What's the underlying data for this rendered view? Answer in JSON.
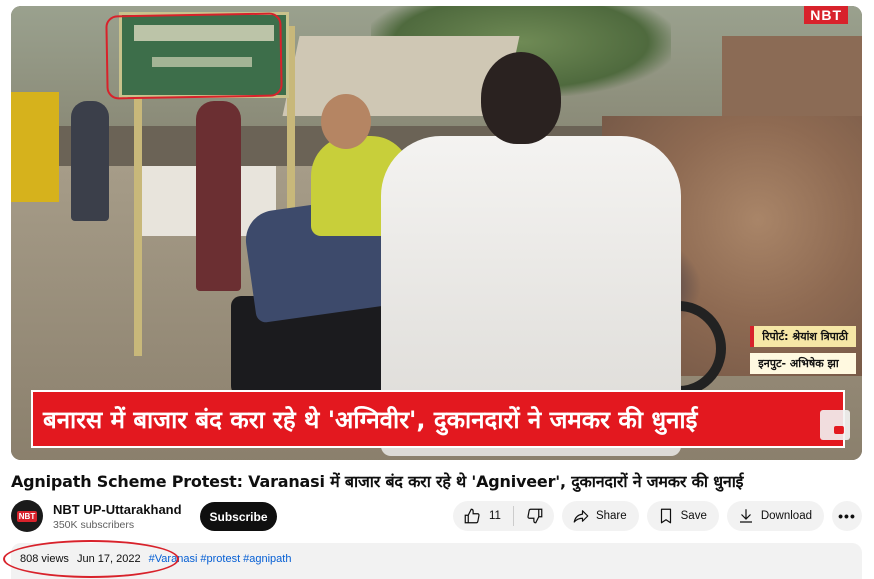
{
  "video": {
    "overlay_logo": "NBT",
    "headline": "बनारस में बाजार बंद करा रहे थे 'अग्निवीर', दुकानदारों ने जमकर की धुनाई",
    "reporter_line": "रिपोर्ट: श्रेयांश त्रिपाठी",
    "input_line": "इनपुट- अभिषेक झा"
  },
  "title": "Agnipath Scheme Protest: Varanasi में बाजार बंद करा रहे थे 'Agniveer', दुकानदारों ने जमकर की धुनाई",
  "channel": {
    "avatar_text": "NBT",
    "name": "NBT UP-Uttarakhand",
    "subscribers": "350K subscribers",
    "subscribe_label": "Subscribe"
  },
  "actions": {
    "like_count": "11",
    "share_label": "Share",
    "save_label": "Save",
    "download_label": "Download",
    "more_label": "•••"
  },
  "description": {
    "views": "808 views",
    "date": "Jun 17, 2022",
    "hashtags": [
      "#Varanasi",
      "#protest",
      "#agnipath"
    ]
  },
  "colors": {
    "accent_red": "#e3181f",
    "subscribe_bg": "#0f0f0f",
    "hashtag_blue": "#065fd4",
    "pill_bg": "#f2f2f2"
  },
  "icons": {
    "like": "thumbs-up-icon",
    "dislike": "thumbs-down-icon",
    "share": "share-icon",
    "save": "save-icon",
    "download": "download-icon",
    "more": "more-icon"
  }
}
